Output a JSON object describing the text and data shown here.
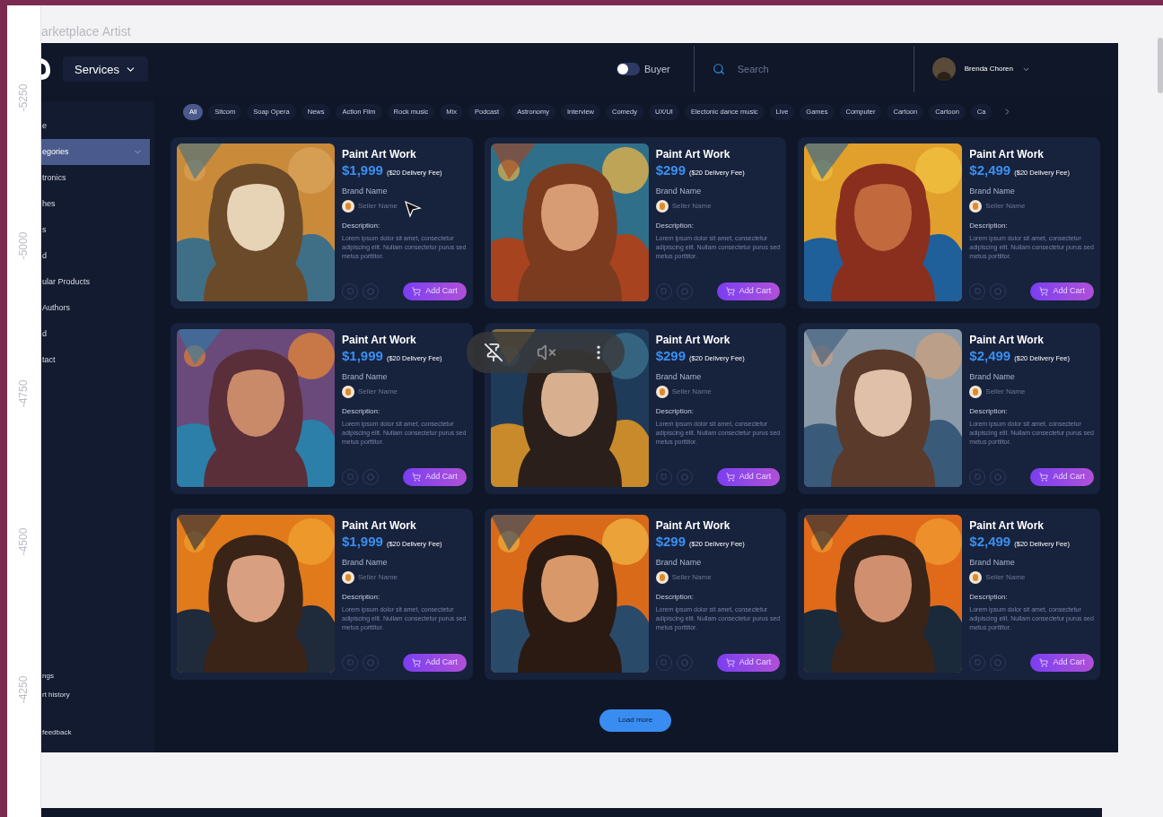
{
  "ruler": [
    "-5250",
    "-5000",
    "-4750",
    "-4500",
    "-4250"
  ],
  "frame_title": "arketplace Artist",
  "topbar": {
    "services": "Services",
    "toggle": {
      "label": "Buyer",
      "on": false
    },
    "search": {
      "placeholder": "Search"
    },
    "user": "Brenda Choren"
  },
  "sidebar": {
    "items": [
      {
        "label": "e",
        "selected": false,
        "kind": "link"
      },
      {
        "label": "egories",
        "selected": true,
        "kind": "dropdown"
      },
      {
        "label": "tronics",
        "selected": false,
        "kind": "link"
      },
      {
        "label": "hes",
        "selected": false,
        "kind": "link"
      },
      {
        "label": "s",
        "selected": false,
        "kind": "link"
      },
      {
        "label": "d",
        "selected": false,
        "kind": "link"
      },
      {
        "label": "ular Products",
        "selected": false,
        "kind": "link"
      },
      {
        "label": "Authors",
        "selected": false,
        "kind": "link"
      },
      {
        "label": "d",
        "selected": false,
        "kind": "link"
      },
      {
        "label": "tact",
        "selected": false,
        "kind": "link"
      }
    ],
    "bottom_items": [
      "ngs",
      "rt history",
      "feedback"
    ]
  },
  "chips": [
    {
      "label": "All",
      "selected": true
    },
    {
      "label": "Sitcom",
      "selected": false
    },
    {
      "label": "Soap Opera",
      "selected": false
    },
    {
      "label": "News",
      "selected": false
    },
    {
      "label": "Action Film",
      "selected": false
    },
    {
      "label": "Rock music",
      "selected": false
    },
    {
      "label": "Mix",
      "selected": false
    },
    {
      "label": "Podcast",
      "selected": false
    },
    {
      "label": "Astronomy",
      "selected": false
    },
    {
      "label": "Interview",
      "selected": false
    },
    {
      "label": "Comedy",
      "selected": false
    },
    {
      "label": "UX/UI",
      "selected": false
    },
    {
      "label": "Electonic dance music",
      "selected": false
    },
    {
      "label": "Live",
      "selected": false
    },
    {
      "label": "Games",
      "selected": false
    },
    {
      "label": "Computer",
      "selected": false
    },
    {
      "label": "Cartoon",
      "selected": false
    },
    {
      "label": "Cartoon",
      "selected": false
    },
    {
      "label": "Ca",
      "selected": false
    }
  ],
  "products": [
    {
      "title": "Paint Art Work",
      "price": "$1,999",
      "fee": "($20 Delivery Fee)",
      "brand": "Brand Name",
      "seller": "Seller Name",
      "description_label": "Description:",
      "description": "Lorem ipsum dolor sit amet, consectetur adipiscing elit. Nullam consectetur purus sed metus porttitor.",
      "button": "Add Cart"
    },
    {
      "title": "Paint Art Work",
      "price": "$299",
      "fee": "($20 Delivery Fee)",
      "brand": "Brand Name",
      "seller": "Seller Name",
      "description_label": "Description:",
      "description": "Lorem ipsum dolor sit amet, consectetur adipiscing elit. Nullam consectetur purus sed metus porttitor.",
      "button": "Add Cart"
    },
    {
      "title": "Paint Art Work",
      "price": "$2,499",
      "fee": "($20 Delivery Fee)",
      "brand": "Brand Name",
      "seller": "Seller Name",
      "description_label": "Description:",
      "description": "Lorem ipsum dolor sit amet, consectetur adipiscing elit. Nullam consectetur purus sed metus porttitor.",
      "button": "Add Cart"
    },
    {
      "title": "Paint Art Work",
      "price": "$1,999",
      "fee": "($20 Delivery Fee)",
      "brand": "Brand Name",
      "seller": "Seller Name",
      "description_label": "Description:",
      "description": "Lorem ipsum dolor sit amet, consectetur adipiscing elit. Nullam consectetur purus sed metus porttitor.",
      "button": "Add Cart"
    },
    {
      "title": "Paint Art Work",
      "price": "$299",
      "fee": "($20 Delivery Fee)",
      "brand": "Brand Name",
      "seller": "Seller Name",
      "description_label": "Description:",
      "description": "Lorem ipsum dolor sit amet, consectetur adipiscing elit. Nullam consectetur purus sed metus porttitor.",
      "button": "Add Cart"
    },
    {
      "title": "Paint Art Work",
      "price": "$2,499",
      "fee": "($20 Delivery Fee)",
      "brand": "Brand Name",
      "seller": "Seller Name",
      "description_label": "Description:",
      "description": "Lorem ipsum dolor sit amet, consectetur adipiscing elit. Nullam consectetur purus sed metus porttitor.",
      "button": "Add Cart"
    },
    {
      "title": "Paint Art Work",
      "price": "$1,999",
      "fee": "($20 Delivery Fee)",
      "brand": "Brand Name",
      "seller": "Seller Name",
      "description_label": "Description:",
      "description": "Lorem ipsum dolor sit amet, consectetur adipiscing elit. Nullam consectetur purus sed metus porttitor.",
      "button": "Add Cart"
    },
    {
      "title": "Paint Art Work",
      "price": "$299",
      "fee": "($20 Delivery Fee)",
      "brand": "Brand Name",
      "seller": "Seller Name",
      "description_label": "Description:",
      "description": "Lorem ipsum dolor sit amet, consectetur adipiscing elit. Nullam consectetur purus sed metus porttitor.",
      "button": "Add Cart"
    },
    {
      "title": "Paint Art Work",
      "price": "$2,499",
      "fee": "($20 Delivery Fee)",
      "brand": "Brand Name",
      "seller": "Seller Name",
      "description_label": "Description:",
      "description": "Lorem ipsum dolor sit amet, consectetur adipiscing elit. Nullam consectetur purus sed metus porttitor.",
      "button": "Add Cart"
    }
  ],
  "load_more": "Load more"
}
